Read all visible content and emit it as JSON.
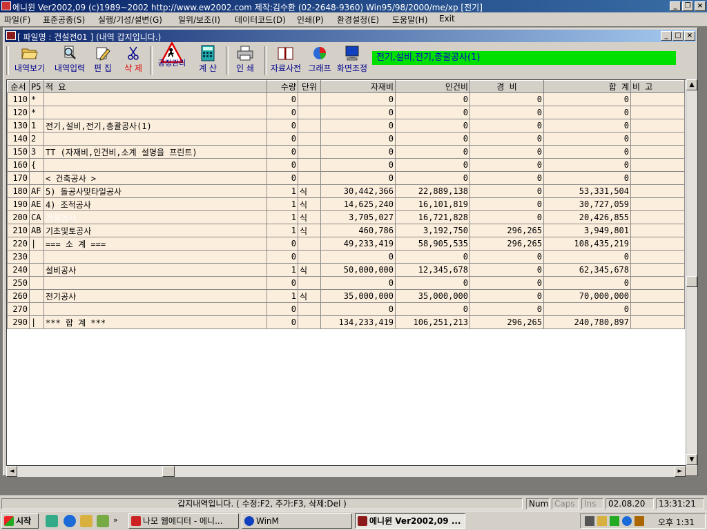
{
  "app": {
    "title": "에니윈 Ver2002,09 (c)1989~2002 http://www.ew2002.com 제작:김수환 (02-2648-9360) Win95/98/2000/me/xp [전기]"
  },
  "menu": [
    "파일(F)",
    "표준공종(S)",
    "실행/기성/설변(G)",
    "일위/보조(I)",
    "데이터코드(D)",
    "인쇄(P)",
    "환경설정(E)",
    "도움말(H)",
    "Exit"
  ],
  "child": {
    "title": "[ 파일명 : 건설전01 ] (내역 갑지입니다.)"
  },
  "toolbar": {
    "tools": [
      {
        "label": "내역보기",
        "icon": "folder-open-icon"
      },
      {
        "label": "내역입력",
        "icon": "magnifier-icon"
      },
      {
        "label": "편 집",
        "icon": "pencil-icon"
      },
      {
        "label": "삭 제",
        "icon": "scissors-icon"
      },
      {
        "label": "공정관리",
        "icon": "construction-sign-icon"
      },
      {
        "label": "계 산",
        "icon": "calculator-icon"
      },
      {
        "label": "인 쇄",
        "icon": "printer-icon"
      },
      {
        "label": "자료사전",
        "icon": "book-icon"
      },
      {
        "label": "그래프",
        "icon": "pie-chart-icon"
      },
      {
        "label": "화면조정",
        "icon": "monitor-icon"
      }
    ],
    "status_text": "전기,설비,전기,총괄공사(1)"
  },
  "grid": {
    "headers": [
      "순서",
      "P5",
      "적 요",
      "수량",
      "단위",
      "자재비",
      "인건비",
      "경 비",
      "합 계",
      "비 고"
    ],
    "rows": [
      [
        "110",
        "*",
        "",
        "0",
        "",
        "0",
        "0",
        "0",
        "0",
        ""
      ],
      [
        "120",
        "*",
        "",
        "0",
        "",
        "0",
        "0",
        "0",
        "0",
        ""
      ],
      [
        "130",
        "1",
        "전기,설비,전기,총괄공사(1)",
        "0",
        "",
        "0",
        "0",
        "0",
        "0",
        ""
      ],
      [
        "140",
        "2",
        "",
        "0",
        "",
        "0",
        "0",
        "0",
        "0",
        ""
      ],
      [
        "150",
        "3",
        "TT (자재비,인건비,소계 설명을 프린트)",
        "0",
        "",
        "0",
        "0",
        "0",
        "0",
        ""
      ],
      [
        "160",
        "{",
        "",
        "0",
        "",
        "0",
        "0",
        "0",
        "0",
        ""
      ],
      [
        "170",
        "",
        "< 건축공사 >",
        "0",
        "",
        "0",
        "0",
        "0",
        "0",
        ""
      ],
      [
        "180",
        "AF",
        "5) 돌공사및타일공사",
        "1",
        "식",
        "30,442,366",
        "22,889,138",
        "0",
        "53,331,504",
        ""
      ],
      [
        "190",
        "AE",
        "4) 조적공사",
        "1",
        "식",
        "14,625,240",
        "16,101,819",
        "0",
        "30,727,059",
        ""
      ],
      [
        "200",
        "CA",
        "가설공사",
        "1",
        "식",
        "3,705,027",
        "16,721,828",
        "0",
        "20,426,855",
        ""
      ],
      [
        "210",
        "AB",
        "기초및토공사",
        "1",
        "식",
        "460,786",
        "3,192,750",
        "296,265",
        "3,949,801",
        ""
      ],
      [
        "220",
        "|",
        "=== 소 계 ===",
        "0",
        "",
        "49,233,419",
        "58,905,535",
        "296,265",
        "108,435,219",
        ""
      ],
      [
        "230",
        "",
        "",
        "0",
        "",
        "0",
        "0",
        "0",
        "0",
        ""
      ],
      [
        "240",
        "",
        "설비공사",
        "1",
        "식",
        "50,000,000",
        "12,345,678",
        "0",
        "62,345,678",
        ""
      ],
      [
        "250",
        "",
        "",
        "0",
        "",
        "0",
        "0",
        "0",
        "0",
        ""
      ],
      [
        "260",
        "",
        "전기공사",
        "1",
        "식",
        "35,000,000",
        "35,000,000",
        "0",
        "70,000,000",
        ""
      ],
      [
        "270",
        "",
        "",
        "0",
        "",
        "0",
        "0",
        "0",
        "0",
        ""
      ],
      [
        "290",
        "|",
        "*** 합 계 ***",
        "0",
        "",
        "134,233,419",
        "106,251,213",
        "296,265",
        "240,780,897",
        ""
      ]
    ],
    "selected_row": 9
  },
  "statusbar": {
    "message": "갑지내역입니다. ( 수정:F2, 추가:F3, 삭제:Del )",
    "num": "Num",
    "caps": "Caps",
    "ins": "Ins",
    "date": "02.08.20",
    "time": "13:31:21"
  },
  "taskbar": {
    "start": "시작",
    "tasks": [
      "나모 웹에디터 - 에니...",
      "WinM",
      "에니윈 Ver2002,09 ..."
    ],
    "clock": "오후 1:31"
  },
  "colors": {
    "title_blue": "#0a246a",
    "grid_row": "#fbeedd",
    "selection": "#000080",
    "status_green": "#00e000"
  }
}
